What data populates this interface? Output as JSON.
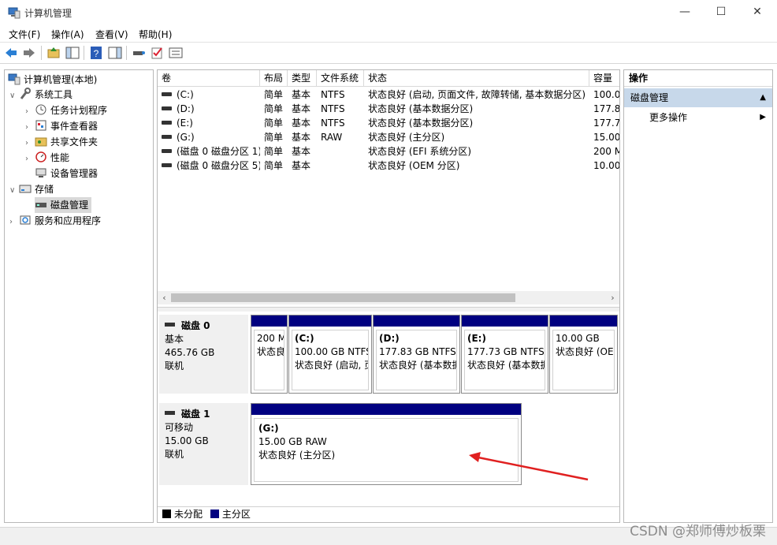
{
  "window": {
    "title": "计算机管理",
    "minimize": "—",
    "maximize": "☐",
    "close": "✕"
  },
  "menu": [
    "文件(F)",
    "操作(A)",
    "查看(V)",
    "帮助(H)"
  ],
  "tree": {
    "root": "计算机管理(本地)",
    "system_tools": "系统工具",
    "task_scheduler": "任务计划程序",
    "event_viewer": "事件查看器",
    "shared_folders": "共享文件夹",
    "performance": "性能",
    "device_manager": "设备管理器",
    "storage": "存储",
    "disk_management": "磁盘管理",
    "services_apps": "服务和应用程序"
  },
  "columns": [
    "卷",
    "布局",
    "类型",
    "文件系统",
    "状态",
    "容量"
  ],
  "volumes": [
    {
      "name": "(C:)",
      "layout": "简单",
      "type": "基本",
      "fs": "NTFS",
      "status": "状态良好 (启动, 页面文件, 故障转储, 基本数据分区)",
      "capacity": "100.00"
    },
    {
      "name": "(D:)",
      "layout": "简单",
      "type": "基本",
      "fs": "NTFS",
      "status": "状态良好 (基本数据分区)",
      "capacity": "177.83"
    },
    {
      "name": "(E:)",
      "layout": "简单",
      "type": "基本",
      "fs": "NTFS",
      "status": "状态良好 (基本数据分区)",
      "capacity": "177.73"
    },
    {
      "name": "(G:)",
      "layout": "简单",
      "type": "基本",
      "fs": "RAW",
      "status": "状态良好 (主分区)",
      "capacity": "15.00"
    },
    {
      "name": "(磁盘 0 磁盘分区 1)",
      "layout": "简单",
      "type": "基本",
      "fs": "",
      "status": "状态良好 (EFI 系统分区)",
      "capacity": "200 M"
    },
    {
      "name": "(磁盘 0 磁盘分区 5)",
      "layout": "简单",
      "type": "基本",
      "fs": "",
      "status": "状态良好 (OEM 分区)",
      "capacity": "10.00"
    }
  ],
  "disks": [
    {
      "name": "磁盘 0",
      "kind": "基本",
      "size": "465.76 GB",
      "state": "联机",
      "partitions": [
        {
          "letter": "",
          "line1": "200 M",
          "line2": "状态良"
        },
        {
          "letter": "(C:)",
          "line1": "100.00 GB NTFS",
          "line2": "状态良好 (启动, 页"
        },
        {
          "letter": "(D:)",
          "line1": "177.83 GB NTFS",
          "line2": "状态良好 (基本数据"
        },
        {
          "letter": "(E:)",
          "line1": "177.73 GB NTFS",
          "line2": "状态良好 (基本数据"
        },
        {
          "letter": "",
          "line1": "10.00 GB",
          "line2": "状态良好 (OE"
        }
      ]
    },
    {
      "name": "磁盘 1",
      "kind": "可移动",
      "size": "15.00 GB",
      "state": "联机",
      "partitions": [
        {
          "letter": "(G:)",
          "line1": "15.00 GB RAW",
          "line2": "状态良好 (主分区)"
        }
      ]
    }
  ],
  "legend": {
    "unallocated": "未分配",
    "primary": "主分区"
  },
  "actions": {
    "header": "操作",
    "section": "磁盘管理",
    "more": "更多操作"
  },
  "watermark": "CSDN @郑师傅炒板栗",
  "colors": {
    "partition_bar": "#000080",
    "action_section": "#c7d8ea",
    "annotation_arrow": "#e02020"
  }
}
